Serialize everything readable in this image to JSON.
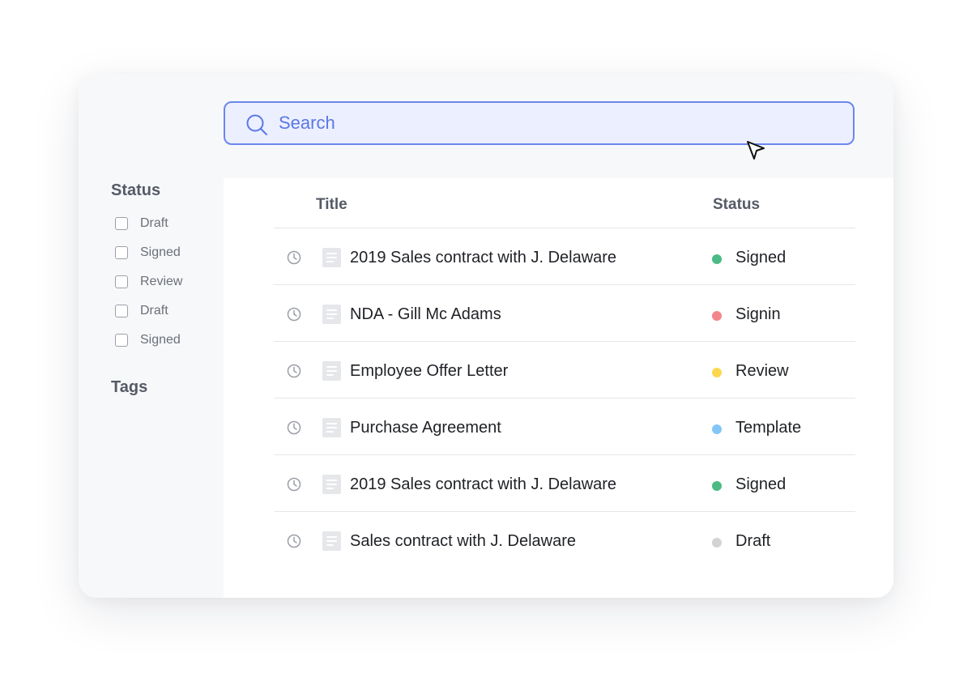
{
  "search": {
    "placeholder": "Search"
  },
  "sidebar": {
    "status_heading": "Status",
    "filters": [
      {
        "label": "Draft",
        "checked": false
      },
      {
        "label": "Signed",
        "checked": false
      },
      {
        "label": "Review",
        "checked": false
      },
      {
        "label": "Draft",
        "checked": false
      },
      {
        "label": "Signed",
        "checked": false
      }
    ],
    "tags_heading": "Tags"
  },
  "table": {
    "columns": {
      "title": "Title",
      "status": "Status"
    },
    "rows": [
      {
        "title": "2019 Sales contract with J. Delaware",
        "status": "Signed",
        "status_color": "#4cba84"
      },
      {
        "title": "NDA - Gill Mc Adams",
        "status": "Signin",
        "status_color": "#f3868c"
      },
      {
        "title": "Employee Offer Letter",
        "status": "Review",
        "status_color": "#fcd74f"
      },
      {
        "title": "Purchase Agreement",
        "status": "Template",
        "status_color": "#82c6f7"
      },
      {
        "title": "2019 Sales contract with J. Delaware",
        "status": "Signed",
        "status_color": "#4cba84"
      },
      {
        "title": "Sales contract with J. Delaware",
        "status": "Draft",
        "status_color": "#d3d3d3"
      }
    ]
  },
  "colors": {
    "accent": "#6b87ee",
    "search_background": "#ecefff",
    "panel_background": "#f7f8fa"
  },
  "icons": {
    "search": "search-icon",
    "cursor": "cursor-arrow-icon",
    "row_history": "clock-icon",
    "row_document": "document-icon"
  }
}
